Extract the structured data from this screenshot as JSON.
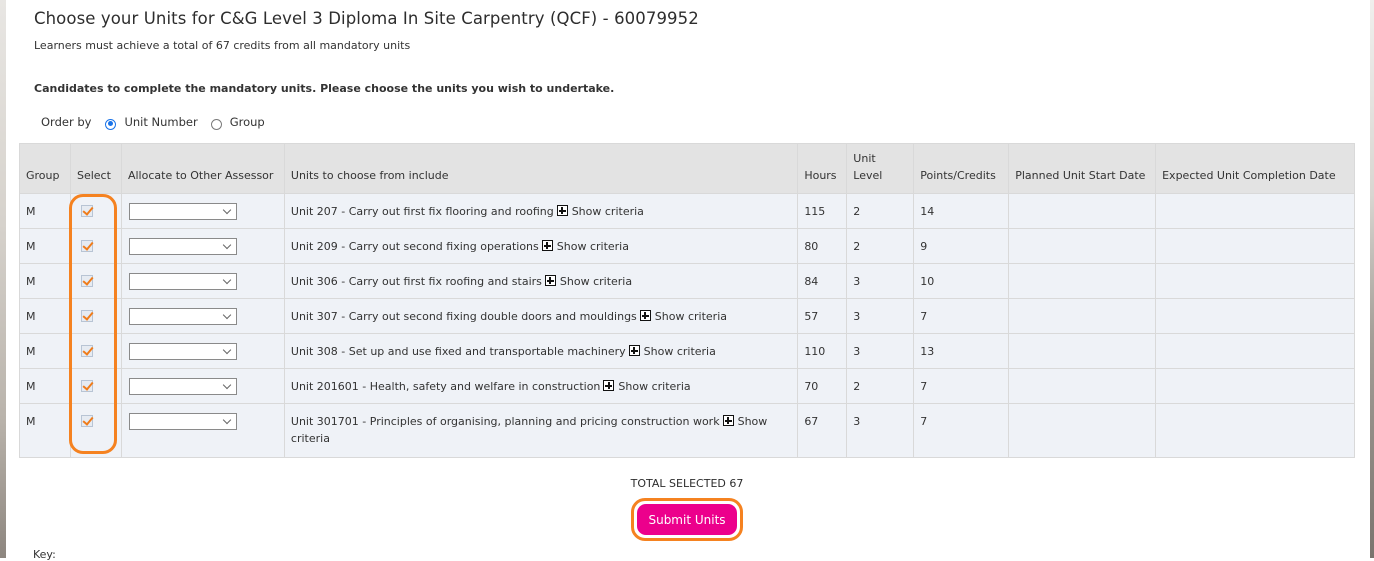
{
  "header": {
    "title": "Choose your Units for C&G Level 3 Diploma In Site Carpentry (QCF) - 60079952",
    "subtitle": "Learners must achieve a total of 67 credits from all mandatory units",
    "instruction": "Candidates to complete the mandatory units. Please choose the units you wish to undertake."
  },
  "order_by": {
    "label": "Order by",
    "options": [
      {
        "label": "Unit Number",
        "selected": true
      },
      {
        "label": "Group",
        "selected": false
      }
    ]
  },
  "table": {
    "columns": {
      "group": "Group",
      "select": "Select",
      "allocate": "Allocate to Other Assessor",
      "units": "Units to choose from include",
      "hours": "Hours",
      "unit_level": "Unit Level",
      "points": "Points/Credits",
      "planned_start": "Planned Unit Start Date",
      "expected_completion": "Expected Unit Completion Date"
    },
    "show_criteria_label": "Show criteria",
    "rows": [
      {
        "group": "M",
        "selected": true,
        "assessor": "",
        "unit": "Unit 207 - Carry out first fix flooring and roofing",
        "hours": "115",
        "level": "2",
        "points": "14",
        "planned_start": "",
        "expected_completion": ""
      },
      {
        "group": "M",
        "selected": true,
        "assessor": "",
        "unit": "Unit 209 - Carry out second fixing operations",
        "hours": "80",
        "level": "2",
        "points": "9",
        "planned_start": "",
        "expected_completion": ""
      },
      {
        "group": "M",
        "selected": true,
        "assessor": "",
        "unit": "Unit 306 - Carry out first fix roofing and stairs",
        "hours": "84",
        "level": "3",
        "points": "10",
        "planned_start": "",
        "expected_completion": ""
      },
      {
        "group": "M",
        "selected": true,
        "assessor": "",
        "unit": "Unit 307 - Carry out second fixing double doors and mouldings",
        "hours": "57",
        "level": "3",
        "points": "7",
        "planned_start": "",
        "expected_completion": ""
      },
      {
        "group": "M",
        "selected": true,
        "assessor": "",
        "unit": "Unit 308 - Set up and use fixed and transportable machinery",
        "hours": "110",
        "level": "3",
        "points": "13",
        "planned_start": "",
        "expected_completion": ""
      },
      {
        "group": "M",
        "selected": true,
        "assessor": "",
        "unit": "Unit 201601 - Health, safety and welfare in construction",
        "hours": "70",
        "level": "2",
        "points": "7",
        "planned_start": "",
        "expected_completion": ""
      },
      {
        "group": "M",
        "selected": true,
        "assessor": "",
        "unit": "Unit 301701 - Principles of organising, planning and pricing construction work",
        "hours": "67",
        "level": "3",
        "points": "7",
        "planned_start": "",
        "expected_completion": ""
      }
    ]
  },
  "footer": {
    "total_selected": "TOTAL SELECTED 67",
    "submit_label": "Submit Units",
    "key_label": "Key:"
  },
  "colors": {
    "submit_bg": "#ec008c",
    "highlight": "#f58220",
    "checkmark": "#f07c1a",
    "header_bg": "#e3e3e3",
    "row_bg": "#eff2f7"
  }
}
